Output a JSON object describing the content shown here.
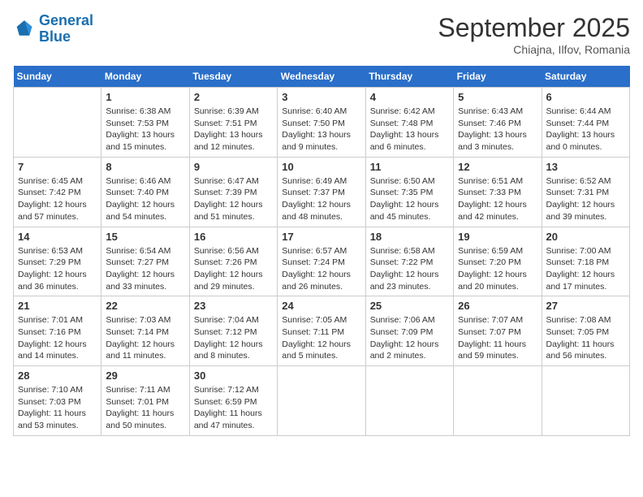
{
  "header": {
    "logo_general": "General",
    "logo_blue": "Blue",
    "month": "September 2025",
    "location": "Chiajna, Ilfov, Romania"
  },
  "weekdays": [
    "Sunday",
    "Monday",
    "Tuesday",
    "Wednesday",
    "Thursday",
    "Friday",
    "Saturday"
  ],
  "weeks": [
    [
      {
        "day": "",
        "info": ""
      },
      {
        "day": "1",
        "info": "Sunrise: 6:38 AM\nSunset: 7:53 PM\nDaylight: 13 hours\nand 15 minutes."
      },
      {
        "day": "2",
        "info": "Sunrise: 6:39 AM\nSunset: 7:51 PM\nDaylight: 13 hours\nand 12 minutes."
      },
      {
        "day": "3",
        "info": "Sunrise: 6:40 AM\nSunset: 7:50 PM\nDaylight: 13 hours\nand 9 minutes."
      },
      {
        "day": "4",
        "info": "Sunrise: 6:42 AM\nSunset: 7:48 PM\nDaylight: 13 hours\nand 6 minutes."
      },
      {
        "day": "5",
        "info": "Sunrise: 6:43 AM\nSunset: 7:46 PM\nDaylight: 13 hours\nand 3 minutes."
      },
      {
        "day": "6",
        "info": "Sunrise: 6:44 AM\nSunset: 7:44 PM\nDaylight: 13 hours\nand 0 minutes."
      }
    ],
    [
      {
        "day": "7",
        "info": "Sunrise: 6:45 AM\nSunset: 7:42 PM\nDaylight: 12 hours\nand 57 minutes."
      },
      {
        "day": "8",
        "info": "Sunrise: 6:46 AM\nSunset: 7:40 PM\nDaylight: 12 hours\nand 54 minutes."
      },
      {
        "day": "9",
        "info": "Sunrise: 6:47 AM\nSunset: 7:39 PM\nDaylight: 12 hours\nand 51 minutes."
      },
      {
        "day": "10",
        "info": "Sunrise: 6:49 AM\nSunset: 7:37 PM\nDaylight: 12 hours\nand 48 minutes."
      },
      {
        "day": "11",
        "info": "Sunrise: 6:50 AM\nSunset: 7:35 PM\nDaylight: 12 hours\nand 45 minutes."
      },
      {
        "day": "12",
        "info": "Sunrise: 6:51 AM\nSunset: 7:33 PM\nDaylight: 12 hours\nand 42 minutes."
      },
      {
        "day": "13",
        "info": "Sunrise: 6:52 AM\nSunset: 7:31 PM\nDaylight: 12 hours\nand 39 minutes."
      }
    ],
    [
      {
        "day": "14",
        "info": "Sunrise: 6:53 AM\nSunset: 7:29 PM\nDaylight: 12 hours\nand 36 minutes."
      },
      {
        "day": "15",
        "info": "Sunrise: 6:54 AM\nSunset: 7:27 PM\nDaylight: 12 hours\nand 33 minutes."
      },
      {
        "day": "16",
        "info": "Sunrise: 6:56 AM\nSunset: 7:26 PM\nDaylight: 12 hours\nand 29 minutes."
      },
      {
        "day": "17",
        "info": "Sunrise: 6:57 AM\nSunset: 7:24 PM\nDaylight: 12 hours\nand 26 minutes."
      },
      {
        "day": "18",
        "info": "Sunrise: 6:58 AM\nSunset: 7:22 PM\nDaylight: 12 hours\nand 23 minutes."
      },
      {
        "day": "19",
        "info": "Sunrise: 6:59 AM\nSunset: 7:20 PM\nDaylight: 12 hours\nand 20 minutes."
      },
      {
        "day": "20",
        "info": "Sunrise: 7:00 AM\nSunset: 7:18 PM\nDaylight: 12 hours\nand 17 minutes."
      }
    ],
    [
      {
        "day": "21",
        "info": "Sunrise: 7:01 AM\nSunset: 7:16 PM\nDaylight: 12 hours\nand 14 minutes."
      },
      {
        "day": "22",
        "info": "Sunrise: 7:03 AM\nSunset: 7:14 PM\nDaylight: 12 hours\nand 11 minutes."
      },
      {
        "day": "23",
        "info": "Sunrise: 7:04 AM\nSunset: 7:12 PM\nDaylight: 12 hours\nand 8 minutes."
      },
      {
        "day": "24",
        "info": "Sunrise: 7:05 AM\nSunset: 7:11 PM\nDaylight: 12 hours\nand 5 minutes."
      },
      {
        "day": "25",
        "info": "Sunrise: 7:06 AM\nSunset: 7:09 PM\nDaylight: 12 hours\nand 2 minutes."
      },
      {
        "day": "26",
        "info": "Sunrise: 7:07 AM\nSunset: 7:07 PM\nDaylight: 11 hours\nand 59 minutes."
      },
      {
        "day": "27",
        "info": "Sunrise: 7:08 AM\nSunset: 7:05 PM\nDaylight: 11 hours\nand 56 minutes."
      }
    ],
    [
      {
        "day": "28",
        "info": "Sunrise: 7:10 AM\nSunset: 7:03 PM\nDaylight: 11 hours\nand 53 minutes."
      },
      {
        "day": "29",
        "info": "Sunrise: 7:11 AM\nSunset: 7:01 PM\nDaylight: 11 hours\nand 50 minutes."
      },
      {
        "day": "30",
        "info": "Sunrise: 7:12 AM\nSunset: 6:59 PM\nDaylight: 11 hours\nand 47 minutes."
      },
      {
        "day": "",
        "info": ""
      },
      {
        "day": "",
        "info": ""
      },
      {
        "day": "",
        "info": ""
      },
      {
        "day": "",
        "info": ""
      }
    ]
  ]
}
